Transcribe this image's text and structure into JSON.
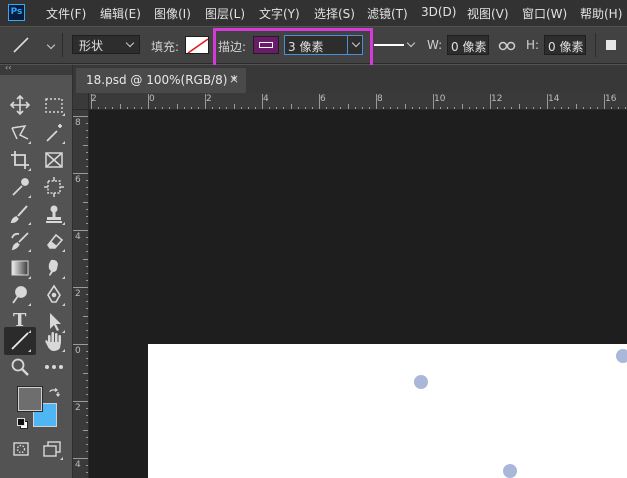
{
  "app": {
    "logo": "Ps"
  },
  "menu": [
    "文件(F)",
    "编辑(E)",
    "图像(I)",
    "图层(L)",
    "文字(Y)",
    "选择(S)",
    "滤镜(T)",
    "3D(D)",
    "视图(V)",
    "窗口(W)",
    "帮助(H)"
  ],
  "options": {
    "tool_icon": "line-tool-icon",
    "mode": "形状",
    "fill_label": "填充:",
    "stroke_label": "描边:",
    "stroke_width": "3 像素",
    "w_label": "W:",
    "w_value": "0 像素",
    "h_label": "H:",
    "h_value": "0 像素"
  },
  "colors": {
    "highlight": "#d63ad6",
    "stroke_swatch": "#6a1b6a",
    "foreground": "#6e6e6e",
    "background": "#4fb6f3",
    "dot": "#a9b8d8",
    "ps_blue": "#31a8ff"
  },
  "document": {
    "tab_title": "18.psd @ 100%(RGB/8) *",
    "close": "×"
  },
  "rulers": {
    "horizontal": [
      "2",
      "0",
      "2",
      "4",
      "6",
      "8",
      "10",
      "12",
      "14",
      "16"
    ],
    "vertical": [
      "8",
      "6",
      "4",
      "2",
      "0",
      "2",
      "4"
    ]
  },
  "toolbar": {
    "collapse": "‹‹",
    "tools": [
      "move-tool",
      "marquee-tool",
      "lasso-tool",
      "magic-wand-tool",
      "crop-tool",
      "frame-tool",
      "eyedropper-tool",
      "ruler-target-tool",
      "brush-tool",
      "stamp-tool",
      "history-brush-tool",
      "eraser-tool",
      "gradient-tool",
      "smudge-tool",
      "dodge-tool",
      "pen-tool",
      "type-tool",
      "path-select-tool",
      "line-tool",
      "hand-tool",
      "zoom-tool",
      "more-tools"
    ],
    "type_tool_glyph": "T"
  }
}
